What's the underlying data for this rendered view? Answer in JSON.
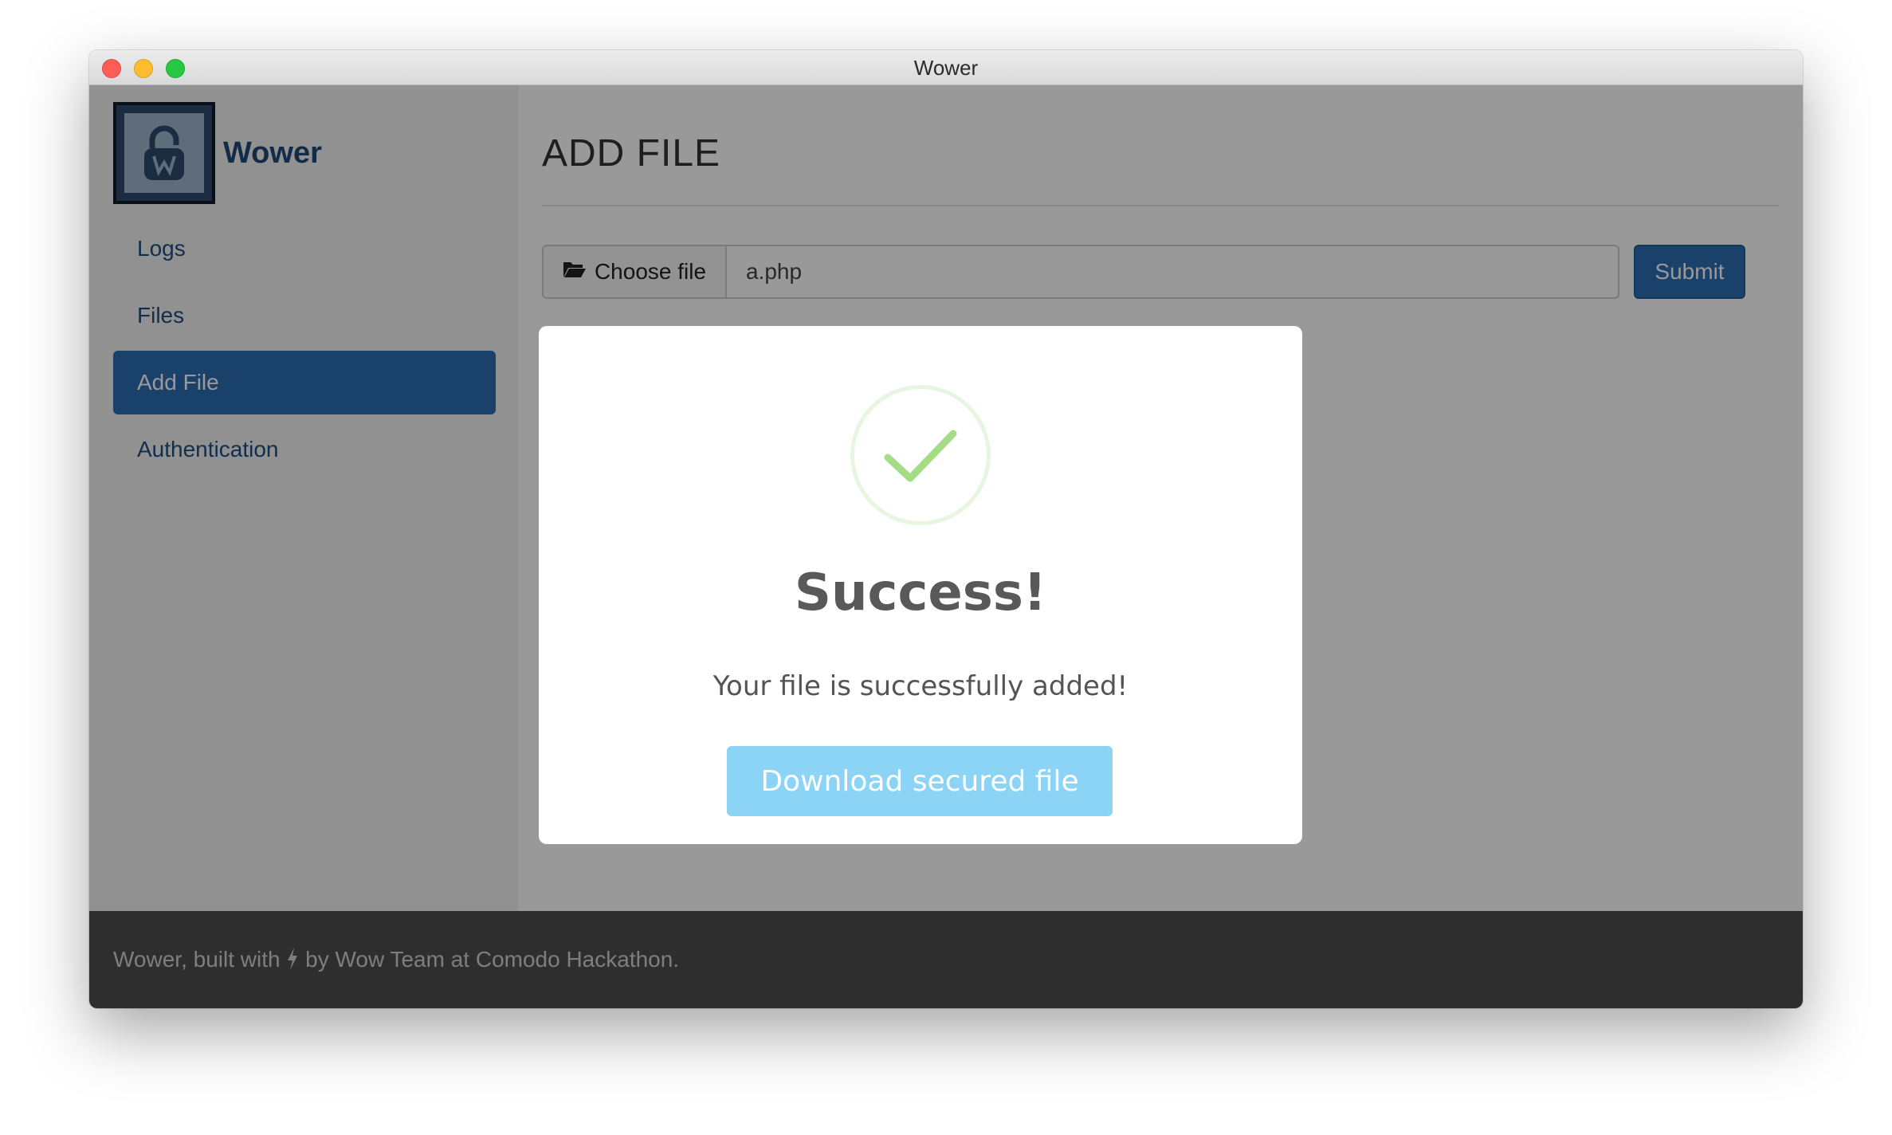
{
  "window": {
    "title": "Wower"
  },
  "sidebar": {
    "brand": "Wower",
    "logo_icon": "lock-icon",
    "items": [
      {
        "label": "Logs",
        "active": false
      },
      {
        "label": "Files",
        "active": false
      },
      {
        "label": "Add File",
        "active": true
      },
      {
        "label": "Authentication",
        "active": false
      }
    ]
  },
  "main": {
    "title": "ADD FILE",
    "file_input": {
      "button_label": "Choose file",
      "button_icon": "folder-open-icon",
      "filename": "a.php"
    },
    "submit_label": "Submit"
  },
  "footer": {
    "text_before": "Wower, built with",
    "icon": "bolt-icon",
    "text_after": "by Wow Team at Comodo Hackathon."
  },
  "modal": {
    "icon": "success-check-icon",
    "title": "Success!",
    "text": "Your file is successfully added!",
    "button_label": "Download secured file"
  },
  "colors": {
    "primary": "#2a6db0",
    "footer_bg": "#4e4e4e",
    "success_green": "#a5dc86",
    "download_button": "#8cd4f5"
  }
}
